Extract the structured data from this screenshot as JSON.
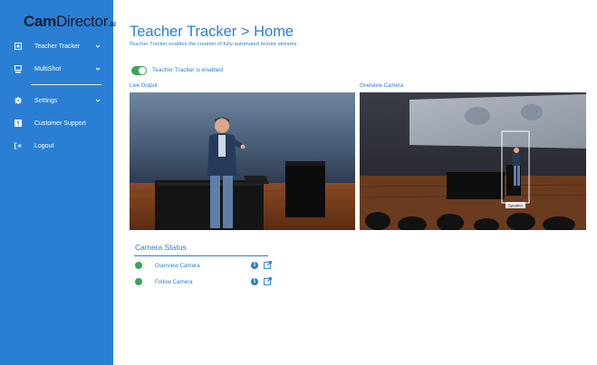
{
  "brand": {
    "bold": "Cam",
    "light": "Director",
    "suffix": ".ai"
  },
  "sidebar": {
    "items": [
      {
        "label": "Teacher Tracker",
        "icon": "grid-icon",
        "has_chevron": true
      },
      {
        "label": "MultiShot",
        "icon": "monitor-icon",
        "has_chevron": true
      },
      {
        "label": "Settings",
        "icon": "gear-icon",
        "has_chevron": true
      },
      {
        "label": "Customer Support",
        "icon": "exclamation-icon",
        "has_chevron": false
      },
      {
        "label": "Logout",
        "icon": "logout-icon",
        "has_chevron": false
      }
    ]
  },
  "main": {
    "title": "Teacher Tracker > Home",
    "subtitle": "Teacher Tracker enables the creation of fully-automated lecture streams.",
    "toggle": {
      "label": "Teacher Tracker is enabled",
      "enabled": true
    },
    "live_output_label": "Live Output",
    "overview_camera_label": "Overview Camera",
    "overview_box_label": "Speaker"
  },
  "camera_status": {
    "title": "Camera Status",
    "cameras": [
      {
        "name": "Overview Camera",
        "status": "online"
      },
      {
        "name": "Follow Camera",
        "status": "online"
      }
    ]
  },
  "colors": {
    "sidebar": "#2a7fd4",
    "accent": "#2a7fd4",
    "status_ok": "#3aa655"
  }
}
